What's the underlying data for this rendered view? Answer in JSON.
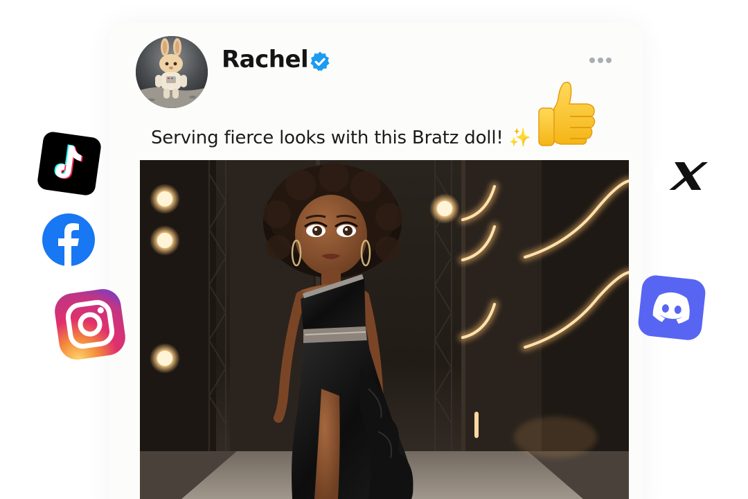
{
  "post": {
    "author_name": "Rachel",
    "verified": true,
    "caption": "Serving fierce looks with this Bratz doll! ✨",
    "avatar_icon": "bunny-astronaut-avatar",
    "more_icon": "more-options-icon",
    "image_subject": "fashion-doll-on-runway-image"
  },
  "reaction": {
    "icon": "thumbs-up-icon"
  },
  "social_icons": [
    {
      "name": "tiktok",
      "icon": "tiktok-icon",
      "color": "#000000"
    },
    {
      "name": "facebook",
      "icon": "facebook-icon",
      "color": "#1877f2"
    },
    {
      "name": "instagram",
      "icon": "instagram-icon",
      "color": "#e1306c"
    },
    {
      "name": "x",
      "icon": "x-icon",
      "color": "#000000"
    },
    {
      "name": "discord",
      "icon": "discord-icon",
      "color": "#5865f2"
    }
  ],
  "colors": {
    "verified_badge": "#1d9bf0",
    "card_background": "#fcfcfb",
    "text_primary": "#141414"
  }
}
